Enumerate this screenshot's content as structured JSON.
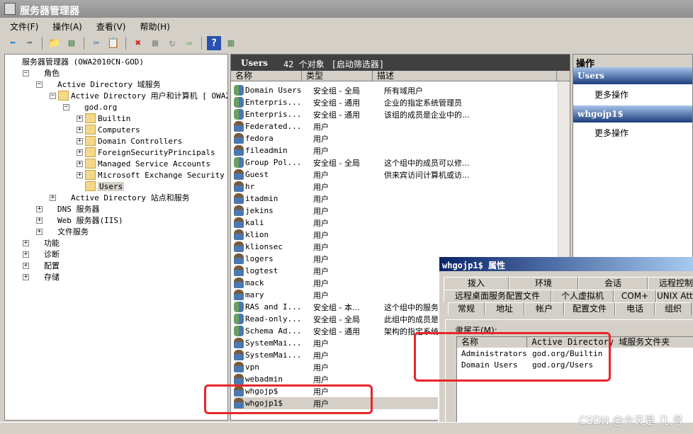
{
  "window": {
    "title": "服务器管理器"
  },
  "menu": [
    "文件(F)",
    "操作(A)",
    "查看(V)",
    "帮助(H)"
  ],
  "toolbar": [
    "back-icon",
    "forward-icon",
    "up-folder-icon",
    "show-tree-icon",
    "cut-icon",
    "paste-icon",
    "delete-icon",
    "properties-icon",
    "refresh-icon",
    "export-icon",
    "help-icon",
    "show-action-pane-icon"
  ],
  "tree": [
    {
      "label": "服务器管理器 (OWA2010CN-GOD)",
      "level": 0,
      "exp": "",
      "icon": "server"
    },
    {
      "label": "角色",
      "level": 1,
      "exp": "-",
      "icon": "server"
    },
    {
      "label": "Active Directory 域服务",
      "level": 2,
      "exp": "-",
      "icon": "server"
    },
    {
      "label": "Active Directory 用户和计算机 [ OWA2010CN-GOD.god.org ]",
      "level": 3,
      "exp": "-",
      "icon": "folder"
    },
    {
      "label": "god.org",
      "level": 4,
      "exp": "-",
      "icon": "server"
    },
    {
      "label": "Builtin",
      "level": 5,
      "exp": "+",
      "icon": "folder"
    },
    {
      "label": "Computers",
      "level": 5,
      "exp": "+",
      "icon": "folder"
    },
    {
      "label": "Domain Controllers",
      "level": 5,
      "exp": "+",
      "icon": "folder"
    },
    {
      "label": "ForeignSecurityPrincipals",
      "level": 5,
      "exp": "+",
      "icon": "folder"
    },
    {
      "label": "Managed Service Accounts",
      "level": 5,
      "exp": "+",
      "icon": "folder"
    },
    {
      "label": "Microsoft Exchange Security Groups",
      "level": 5,
      "exp": "+",
      "icon": "folder"
    },
    {
      "label": "Users",
      "level": 5,
      "exp": "",
      "icon": "folder",
      "selected": true
    },
    {
      "label": "Active Directory 站点和服务",
      "level": 3,
      "exp": "+",
      "icon": "server"
    },
    {
      "label": "DNS 服务器",
      "level": 2,
      "exp": "+",
      "icon": "server"
    },
    {
      "label": "Web 服务器(IIS)",
      "level": 2,
      "exp": "+",
      "icon": "server"
    },
    {
      "label": "文件服务",
      "level": 2,
      "exp": "+",
      "icon": "server"
    },
    {
      "label": "功能",
      "level": 1,
      "exp": "+",
      "icon": "server"
    },
    {
      "label": "诊断",
      "level": 1,
      "exp": "+",
      "icon": "server"
    },
    {
      "label": "配置",
      "level": 1,
      "exp": "+",
      "icon": "server"
    },
    {
      "label": "存储",
      "level": 1,
      "exp": "+",
      "icon": "server"
    }
  ],
  "center": {
    "title": "Users",
    "count": "42 个对象",
    "filter": "[启动筛选器]",
    "columns": [
      "名称",
      "类型",
      "描述"
    ],
    "rows": [
      [
        "Domain Users",
        "安全组 - 全局",
        "所有域用户",
        "group"
      ],
      [
        "Enterpris...",
        "安全组 - 通用",
        "企业的指定系统管理员",
        "group"
      ],
      [
        "Enterpris...",
        "安全组 - 通用",
        "该组的成员是企业中的...",
        "group"
      ],
      [
        "Federated...",
        "用户",
        "",
        "user"
      ],
      [
        "fedora",
        "用户",
        "",
        "user"
      ],
      [
        "fileadmin",
        "用户",
        "",
        "user"
      ],
      [
        "Group Pol...",
        "安全组 - 全局",
        "这个组中的成员可以修...",
        "group"
      ],
      [
        "Guest",
        "用户",
        "供来宾访问计算机或访...",
        "user"
      ],
      [
        "hr",
        "用户",
        "",
        "user"
      ],
      [
        "itadmin",
        "用户",
        "",
        "user"
      ],
      [
        "jekins",
        "用户",
        "",
        "user"
      ],
      [
        "kali",
        "用户",
        "",
        "user"
      ],
      [
        "klion",
        "用户",
        "",
        "user"
      ],
      [
        "klionsec",
        "用户",
        "",
        "user"
      ],
      [
        "logers",
        "用户",
        "",
        "user"
      ],
      [
        "logtest",
        "用户",
        "",
        "user"
      ],
      [
        "mack",
        "用户",
        "",
        "user"
      ],
      [
        "mary",
        "用户",
        "",
        "user"
      ],
      [
        "RAS and I...",
        "安全组 - 本...",
        "这个组中的服务器可以...",
        "group"
      ],
      [
        "Read-only...",
        "安全组 - 全局",
        "此组中的成员是域中只...",
        "group"
      ],
      [
        "Schema Ad...",
        "安全组 - 通用",
        "架构的指定系统管理员",
        "group"
      ],
      [
        "SystemMai...",
        "用户",
        "",
        "user"
      ],
      [
        "SystemMai...",
        "用户",
        "",
        "user"
      ],
      [
        "vpn",
        "用户",
        "",
        "user"
      ],
      [
        "webadmin",
        "用户",
        "",
        "user"
      ],
      [
        "whgojp$",
        "用户",
        "",
        "user"
      ],
      [
        "whgojp1$",
        "用户",
        "",
        "user"
      ]
    ],
    "selected_row": 26
  },
  "actions": {
    "title": "操作",
    "sections": [
      {
        "title": "Users",
        "item": "更多操作"
      },
      {
        "title": "whgojp1$",
        "item": "更多操作"
      }
    ]
  },
  "dialog": {
    "title": "whgojp1$ 属性",
    "tabs1": [
      "拨入",
      "环境",
      "会话",
      "远程控制"
    ],
    "tabs2": [
      "远程桌面服务配置文件",
      "个人虚拟机",
      "COM+",
      "UNIX Attributes"
    ],
    "tabs3": [
      "常规",
      "地址",
      "帐户",
      "配置文件",
      "电话",
      "组织"
    ],
    "member_label": "隶属于(M):",
    "member_columns": [
      "名称",
      "Active Directory 域服务文件夹"
    ],
    "members": [
      [
        "Administrators",
        "god.org/Builtin"
      ],
      [
        "Domain Users",
        "god.org/Users"
      ]
    ]
  },
  "watermark": "CSDN @今天是 几 号",
  "colors": {
    "highlight": "#e8262a",
    "action_band": "#1d3d7e",
    "list_header": "#404040"
  }
}
